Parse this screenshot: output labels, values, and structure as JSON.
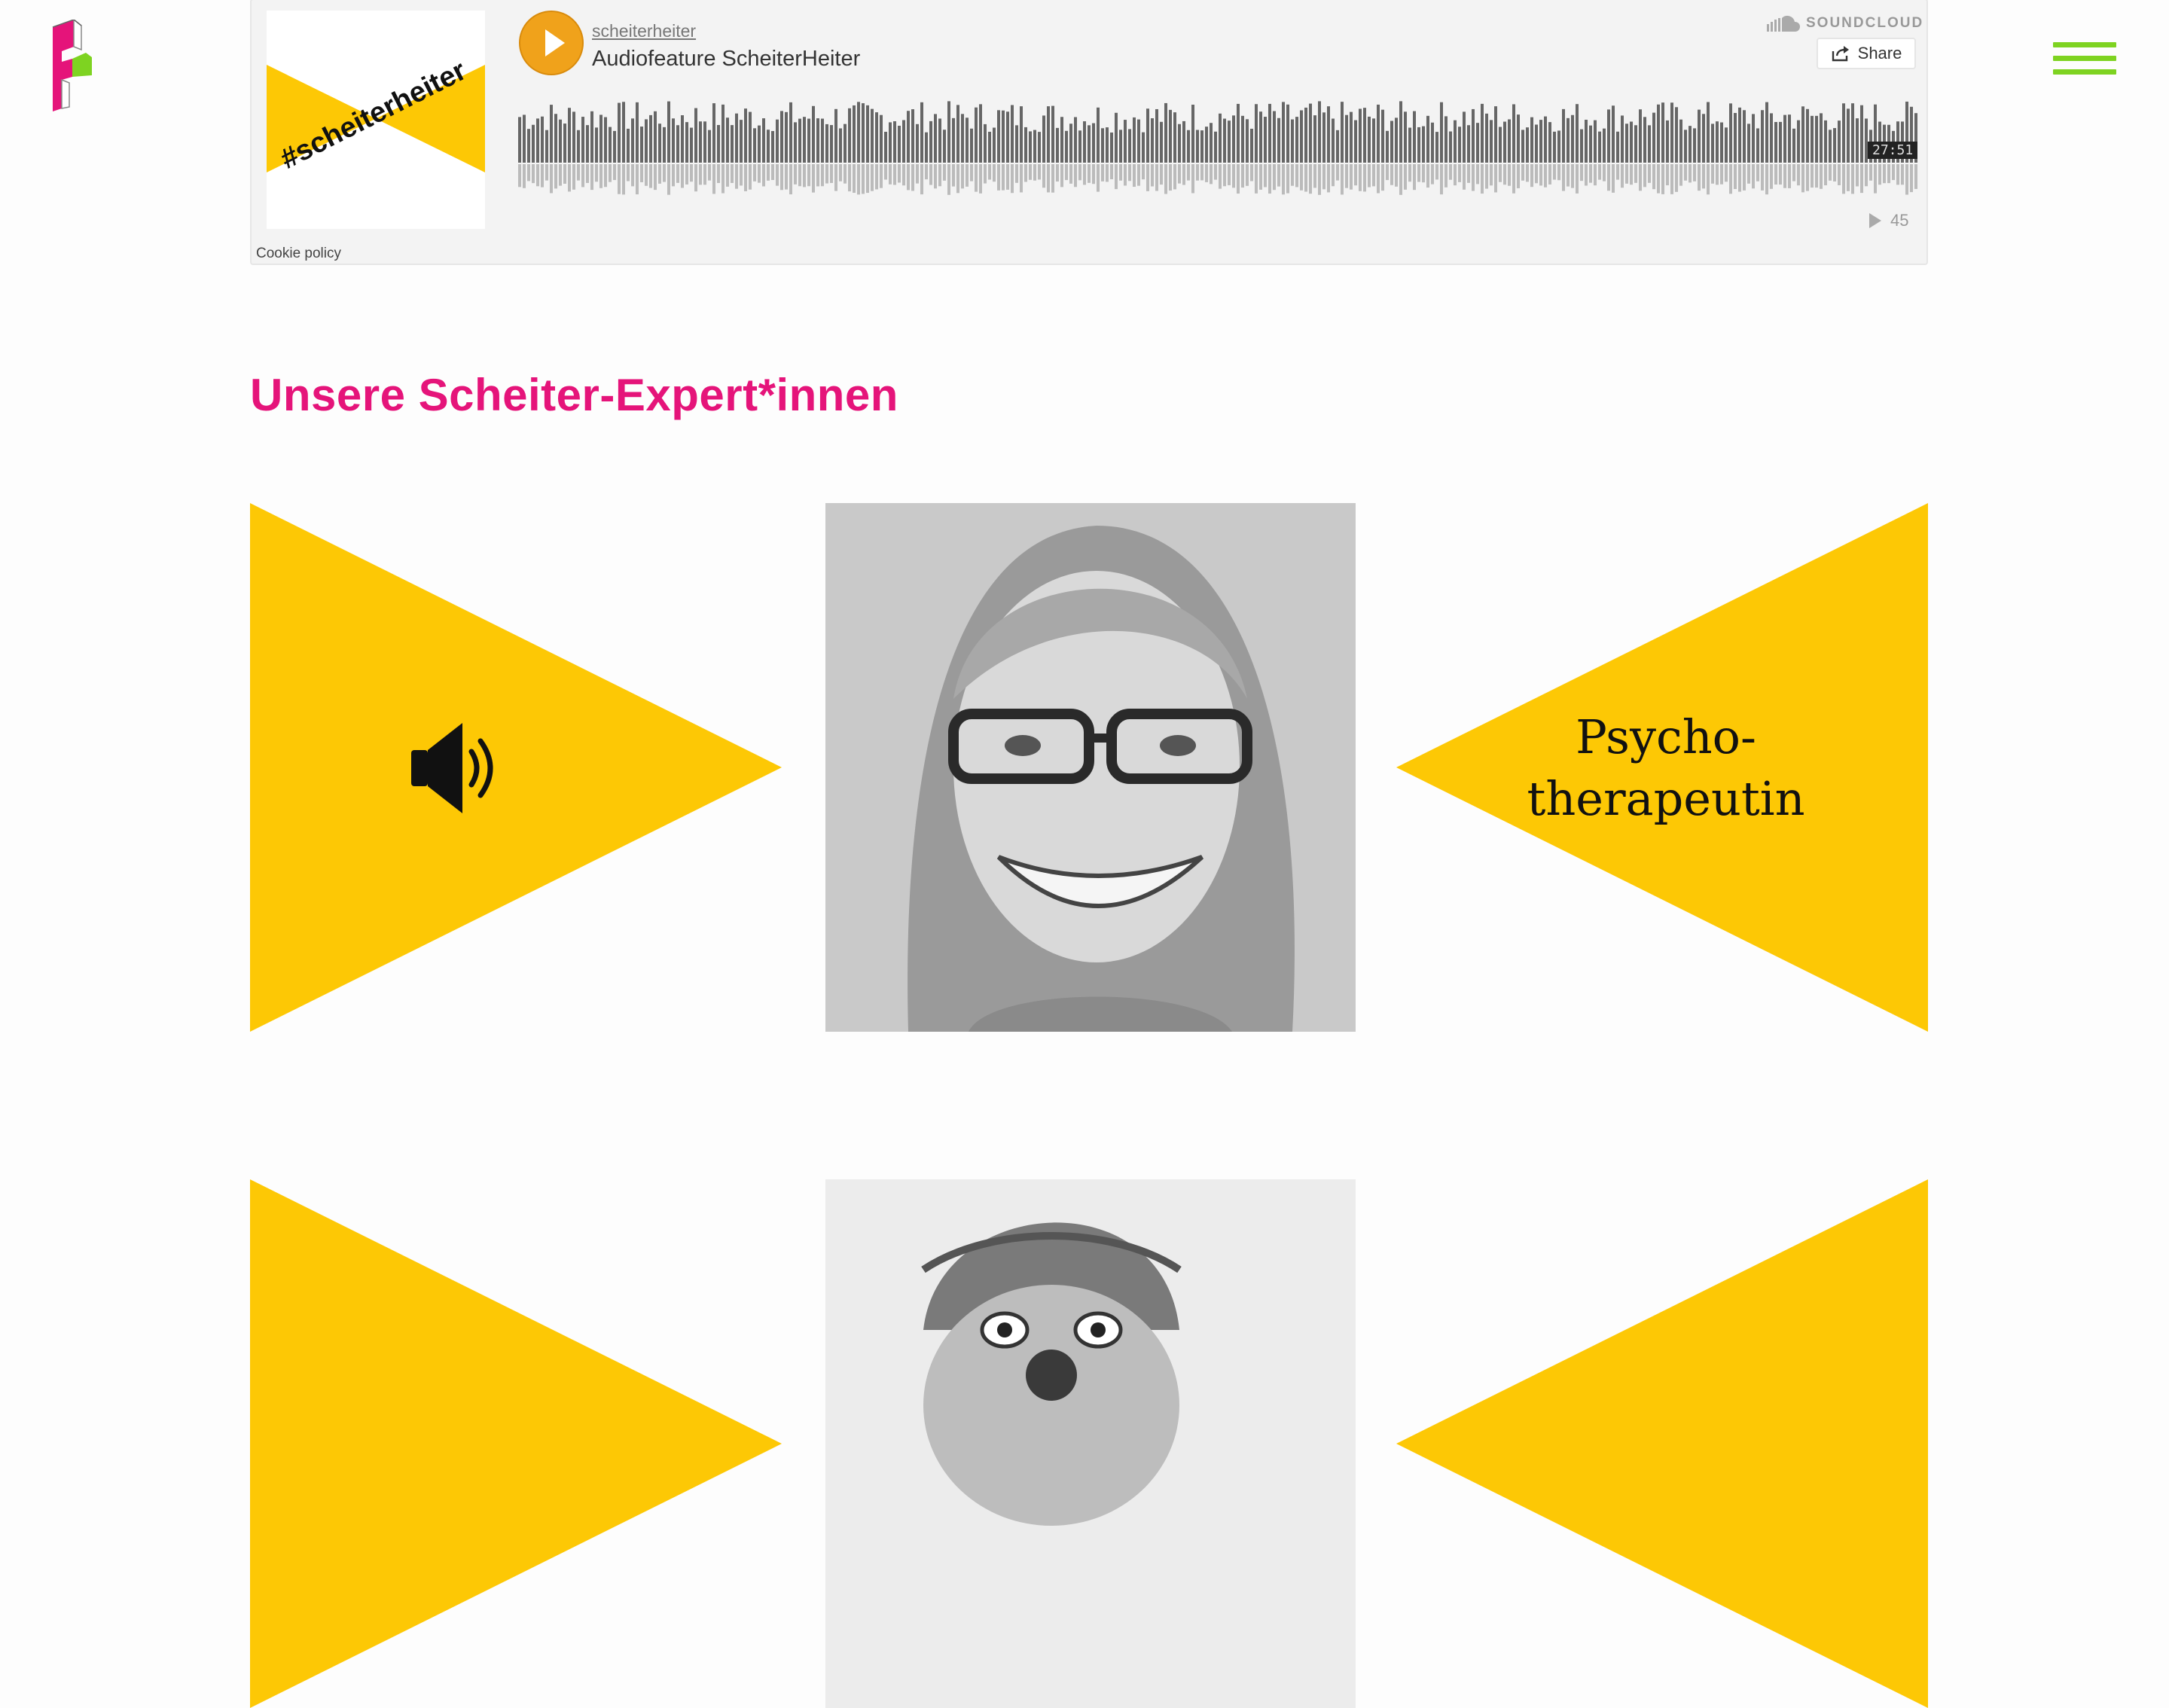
{
  "soundcloud": {
    "user": "scheiterheiter",
    "track_title": "Audiofeature ScheiterHeiter",
    "brand": "SOUNDCLOUD",
    "share_label": "Share",
    "duration": "27:51",
    "plays": "45",
    "cookie_policy": "Cookie policy",
    "artwork_text": "#scheiterheiter",
    "accent_color": "#f0a21b"
  },
  "section": {
    "title": "Unsere Scheiter-Expert*innen"
  },
  "experts": [
    {
      "role": "Psycho-therapeutin",
      "icon": "speaker-icon"
    }
  ],
  "colors": {
    "brand_pink": "#e5147a",
    "triangle_yellow": "#fdc805",
    "menu_green": "#7ed321"
  }
}
